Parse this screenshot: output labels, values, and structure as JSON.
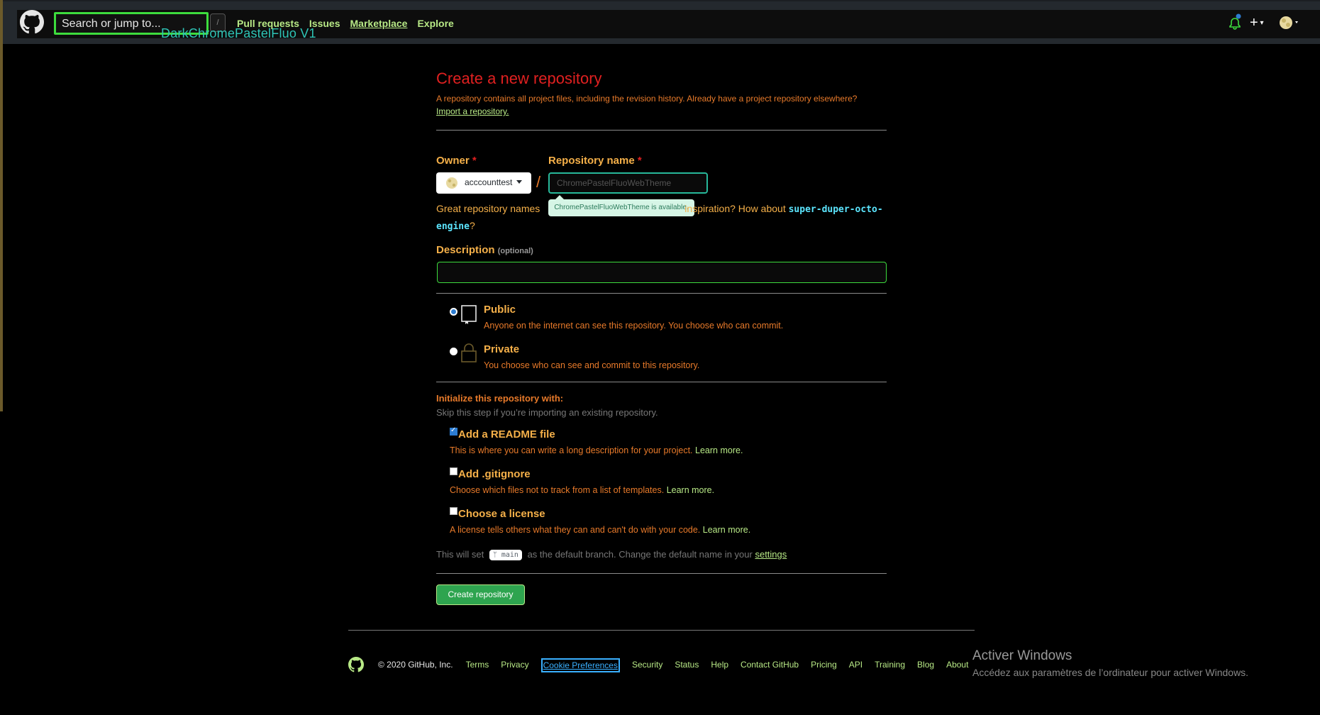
{
  "header": {
    "search_placeholder": "Search or jump to...",
    "slash_key": "/",
    "theme_tag": "DarkChromePastelFluo V1",
    "nav": [
      "Pull requests",
      "Issues",
      "Marketplace",
      "Explore"
    ],
    "plus_label": "+"
  },
  "form": {
    "title": "Create a new repository",
    "subtitle": "A repository contains all project files, including the revision history. Already have a project repository elsewhere?",
    "import_link": "Import a repository.",
    "owner_label": "Owner",
    "required_mark": "*",
    "owner_name": "acccounttest",
    "slash": "/",
    "repo_name_label": "Repository name",
    "repo_name_placeholder": "ChromePastelFluoWebTheme",
    "availability": "ChromePastelFluoWebTheme is available.",
    "great_prefix": "Great repository names",
    "great_suffix": "inspiration? How about",
    "suggestion": "super-duper-octo-engine",
    "question_mark": "?",
    "description_label": "Description",
    "optional": "(optional)",
    "public_title": "Public",
    "public_desc": "Anyone on the internet can see this repository. You choose who can commit.",
    "private_title": "Private",
    "private_desc": "You choose who can see and commit to this repository.",
    "init_title": "Initialize this repository with:",
    "init_sub": "Skip this step if you’re importing an existing repository.",
    "readme_title": "Add a README file",
    "readme_desc": "This is where you can write a long description for your project.",
    "gitignore_title": "Add .gitignore",
    "gitignore_desc": "Choose which files not to track from a list of templates.",
    "license_title": "Choose a license",
    "license_desc": "A license tells others what they can and can't do with your code.",
    "learn_more": "Learn more.",
    "branch_prefix": "This will set",
    "branch_name": "main",
    "branch_suffix": "as the default branch. Change the default name in your",
    "settings_link": "settings",
    "create_button": "Create repository"
  },
  "footer": {
    "copyright": "© 2020 GitHub, Inc.",
    "links": [
      "Terms",
      "Privacy",
      "Cookie Preferences",
      "Security",
      "Status",
      "Help",
      "Contact GitHub",
      "Pricing",
      "API",
      "Training",
      "Blog",
      "About"
    ]
  },
  "watermark": {
    "title": "Activer Windows",
    "subtitle": "Accédez aux paramètres de l’ordinateur pour activer Windows."
  },
  "colors": {
    "accent_green": "#b8e986",
    "title_red": "#e02020",
    "label_orange": "#f5b049",
    "text_orange": "#e87a2a",
    "button_green": "#2ea44f"
  }
}
